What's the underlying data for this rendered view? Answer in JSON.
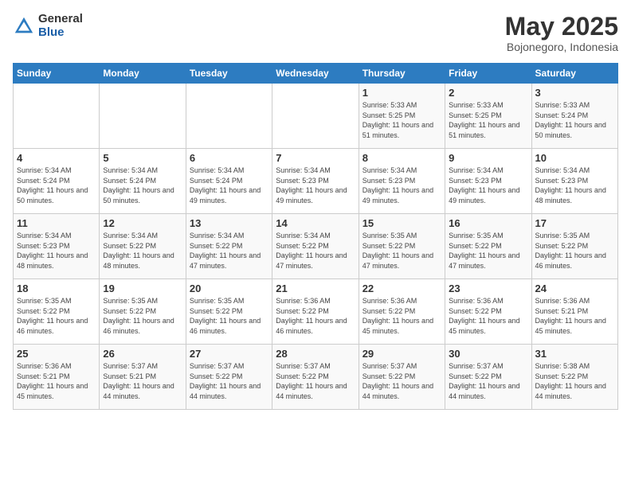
{
  "header": {
    "logo_general": "General",
    "logo_blue": "Blue",
    "month": "May 2025",
    "location": "Bojonegoro, Indonesia"
  },
  "days_of_week": [
    "Sunday",
    "Monday",
    "Tuesday",
    "Wednesday",
    "Thursday",
    "Friday",
    "Saturday"
  ],
  "weeks": [
    [
      {
        "day": "",
        "info": ""
      },
      {
        "day": "",
        "info": ""
      },
      {
        "day": "",
        "info": ""
      },
      {
        "day": "",
        "info": ""
      },
      {
        "day": "1",
        "info": "Sunrise: 5:33 AM\nSunset: 5:25 PM\nDaylight: 11 hours and 51 minutes."
      },
      {
        "day": "2",
        "info": "Sunrise: 5:33 AM\nSunset: 5:25 PM\nDaylight: 11 hours and 51 minutes."
      },
      {
        "day": "3",
        "info": "Sunrise: 5:33 AM\nSunset: 5:24 PM\nDaylight: 11 hours and 50 minutes."
      }
    ],
    [
      {
        "day": "4",
        "info": "Sunrise: 5:34 AM\nSunset: 5:24 PM\nDaylight: 11 hours and 50 minutes."
      },
      {
        "day": "5",
        "info": "Sunrise: 5:34 AM\nSunset: 5:24 PM\nDaylight: 11 hours and 50 minutes."
      },
      {
        "day": "6",
        "info": "Sunrise: 5:34 AM\nSunset: 5:24 PM\nDaylight: 11 hours and 49 minutes."
      },
      {
        "day": "7",
        "info": "Sunrise: 5:34 AM\nSunset: 5:23 PM\nDaylight: 11 hours and 49 minutes."
      },
      {
        "day": "8",
        "info": "Sunrise: 5:34 AM\nSunset: 5:23 PM\nDaylight: 11 hours and 49 minutes."
      },
      {
        "day": "9",
        "info": "Sunrise: 5:34 AM\nSunset: 5:23 PM\nDaylight: 11 hours and 49 minutes."
      },
      {
        "day": "10",
        "info": "Sunrise: 5:34 AM\nSunset: 5:23 PM\nDaylight: 11 hours and 48 minutes."
      }
    ],
    [
      {
        "day": "11",
        "info": "Sunrise: 5:34 AM\nSunset: 5:23 PM\nDaylight: 11 hours and 48 minutes."
      },
      {
        "day": "12",
        "info": "Sunrise: 5:34 AM\nSunset: 5:22 PM\nDaylight: 11 hours and 48 minutes."
      },
      {
        "day": "13",
        "info": "Sunrise: 5:34 AM\nSunset: 5:22 PM\nDaylight: 11 hours and 47 minutes."
      },
      {
        "day": "14",
        "info": "Sunrise: 5:34 AM\nSunset: 5:22 PM\nDaylight: 11 hours and 47 minutes."
      },
      {
        "day": "15",
        "info": "Sunrise: 5:35 AM\nSunset: 5:22 PM\nDaylight: 11 hours and 47 minutes."
      },
      {
        "day": "16",
        "info": "Sunrise: 5:35 AM\nSunset: 5:22 PM\nDaylight: 11 hours and 47 minutes."
      },
      {
        "day": "17",
        "info": "Sunrise: 5:35 AM\nSunset: 5:22 PM\nDaylight: 11 hours and 46 minutes."
      }
    ],
    [
      {
        "day": "18",
        "info": "Sunrise: 5:35 AM\nSunset: 5:22 PM\nDaylight: 11 hours and 46 minutes."
      },
      {
        "day": "19",
        "info": "Sunrise: 5:35 AM\nSunset: 5:22 PM\nDaylight: 11 hours and 46 minutes."
      },
      {
        "day": "20",
        "info": "Sunrise: 5:35 AM\nSunset: 5:22 PM\nDaylight: 11 hours and 46 minutes."
      },
      {
        "day": "21",
        "info": "Sunrise: 5:36 AM\nSunset: 5:22 PM\nDaylight: 11 hours and 46 minutes."
      },
      {
        "day": "22",
        "info": "Sunrise: 5:36 AM\nSunset: 5:22 PM\nDaylight: 11 hours and 45 minutes."
      },
      {
        "day": "23",
        "info": "Sunrise: 5:36 AM\nSunset: 5:22 PM\nDaylight: 11 hours and 45 minutes."
      },
      {
        "day": "24",
        "info": "Sunrise: 5:36 AM\nSunset: 5:21 PM\nDaylight: 11 hours and 45 minutes."
      }
    ],
    [
      {
        "day": "25",
        "info": "Sunrise: 5:36 AM\nSunset: 5:21 PM\nDaylight: 11 hours and 45 minutes."
      },
      {
        "day": "26",
        "info": "Sunrise: 5:37 AM\nSunset: 5:21 PM\nDaylight: 11 hours and 44 minutes."
      },
      {
        "day": "27",
        "info": "Sunrise: 5:37 AM\nSunset: 5:22 PM\nDaylight: 11 hours and 44 minutes."
      },
      {
        "day": "28",
        "info": "Sunrise: 5:37 AM\nSunset: 5:22 PM\nDaylight: 11 hours and 44 minutes."
      },
      {
        "day": "29",
        "info": "Sunrise: 5:37 AM\nSunset: 5:22 PM\nDaylight: 11 hours and 44 minutes."
      },
      {
        "day": "30",
        "info": "Sunrise: 5:37 AM\nSunset: 5:22 PM\nDaylight: 11 hours and 44 minutes."
      },
      {
        "day": "31",
        "info": "Sunrise: 5:38 AM\nSunset: 5:22 PM\nDaylight: 11 hours and 44 minutes."
      }
    ]
  ]
}
